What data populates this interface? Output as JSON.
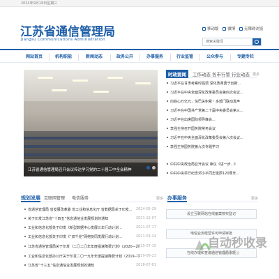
{
  "topbar": {
    "date": "2024年9月18日星期三"
  },
  "header": {
    "title": "江苏省通信管理局",
    "subtitle": "Jiangsu Communications Administration",
    "quick_links": [
      "移动版",
      "微博",
      "无障碍浏览"
    ],
    "search_placeholder": "搜索关键词"
  },
  "nav": {
    "items": [
      "网站首页",
      "机构职能",
      "新闻动态",
      "政务公开",
      "办事服务",
      "行业监管",
      "公众参与",
      "专题专栏"
    ]
  },
  "banner": {
    "caption": "江苏省通信管理局召开会议传达学习党的二十届三中全会精神",
    "dots": 5,
    "active_dot": 0
  },
  "news": {
    "tabs": [
      "时政要闻",
      "工作动态",
      "各市行管",
      "行业动态"
    ],
    "more": "更多",
    "items": [
      "习近平在甘肃考察时强调 深化改革勇于创新...",
      "习近平在中央全面深化改革委员会第四次会议...",
      "向铁心万亿元，信巴关积累！多部门联动发声",
      "习近平在中国共产党第二十届中央委员会第三...",
      "习近平在出席国际领导峰会...",
      "李强主持召开国务院常务会议",
      "习近平在中央全面深化改革委员会第六次会议...",
      "李强主持国务院第九次专题学习",
      "中共中央政治局召开会议 审议《进一步...》",
      "中共中央举行纪念邓小平同志诞辰120周年..."
    ]
  },
  "planning": {
    "title": "规划发展",
    "tabs": [
      "互联网管理",
      "电信服务"
    ],
    "more": "更多",
    "items": [
      {
        "title": "省通信管理局 省发展改革委 省工业和信息化厅 省数据局关于印发...",
        "date": "2024-05-29"
      },
      {
        "title": "关于印发江苏省“十四五”信息通信业发展规划的通知",
        "date": "2021-12-07"
      },
      {
        "title": "工业和信息化部关于印发《新型数据中心发展三年行动计划...",
        "date": "2021-07-17"
      },
      {
        "title": "工业和信息化部关于印发《“双千兆”网络协同发展行动计划...",
        "date": "2021-03-24"
      },
      {
        "title": "江苏省通信管理局关于印发〈二〇二〇年年度提速降费计划〉(2020—2022)",
        "date": "2020-07-15"
      },
      {
        "title": "工业和信息化部办公厅关于印发二〇一九年年度提速降费计划（2019—2021）",
        "date": "2019-06-23"
      },
      {
        "title": "江苏省“十三五”信息通信业发展规划的通知",
        "date": "2018-07-01"
      }
    ]
  },
  "services": {
    "title": "办事服务",
    "more": "更多",
    "items": [
      "设立互联网站在线备案核实登记",
      "电信业务经营许可申请审批",
      "在线办理和查询通信管理局事项"
    ]
  },
  "watermark": {
    "text": "自动秒收录",
    "sub": "来访一次 自动收录"
  },
  "colors": {
    "brand": "#1f5fa8",
    "text": "#333333"
  }
}
